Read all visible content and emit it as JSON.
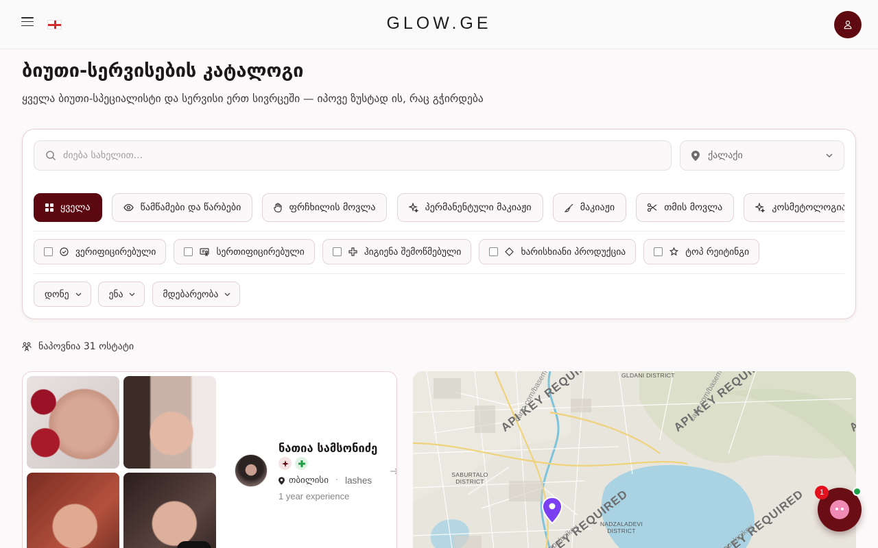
{
  "header": {
    "brand": "GLOW.GE",
    "menu_icon": "hamburger-icon",
    "language_flag": "georgia-flag-icon",
    "user_icon": "user-icon"
  },
  "hero": {
    "title": "ბიუთი-სერვისების კატალოგი",
    "subtitle": "ყველა ბიუთი-სპეციალისტი და სერვისი ერთ სივრცეში — იპოვე ზუსტად ის, რაც გჭირდება"
  },
  "filters": {
    "search_placeholder": "ძიება სახელით...",
    "city_label": "ქალაქი",
    "categories": [
      {
        "label": "ყველა",
        "icon": "grid-icon",
        "active": true
      },
      {
        "label": "წამწამები და წარბები",
        "icon": "eye-icon",
        "active": false
      },
      {
        "label": "ფრჩხილის მოვლა",
        "icon": "hand-icon",
        "active": false
      },
      {
        "label": "პერმანენტული მაკიაჟი",
        "icon": "sparkle-icon",
        "active": false
      },
      {
        "label": "მაკიაჟი",
        "icon": "brush-icon",
        "active": false
      },
      {
        "label": "თმის მოვლა",
        "icon": "scissors-icon",
        "active": false
      },
      {
        "label": "კოსმეტოლოგია და",
        "icon": "sparkle-icon",
        "active": false
      }
    ],
    "checks": [
      {
        "label": "ვერიფიცირებული",
        "icon": "check-circle-icon"
      },
      {
        "label": "სერთიფიცირებული",
        "icon": "certificate-icon"
      },
      {
        "label": "ჰიგიენა შემოწმებული",
        "icon": "plus-badge-icon"
      },
      {
        "label": "ხარისხიანი პროდუქცია",
        "icon": "diamond-icon"
      },
      {
        "label": "ტოპ რეიტინგი",
        "icon": "star-icon"
      }
    ],
    "dropdowns": [
      {
        "label": "დონე"
      },
      {
        "label": "ენა"
      },
      {
        "label": "მდებარეობა"
      }
    ]
  },
  "results": {
    "count_text": "ნაპოვნია 31 ოსტატი"
  },
  "master": {
    "name": "ნათია სამსონიძე",
    "city": "თბილისი",
    "specialty": "lashes",
    "experience": "1 year experience"
  },
  "map": {
    "districts": [
      "GLDANI DISTRICT",
      "SABURTALO DISTRICT",
      "NADZALADEVI DISTRICT"
    ],
    "watermark": "API KEY REQUIRED",
    "watermark_small_1": "carto.com/basem",
    "watermark_small_2": "maps/apikey",
    "marker_color": "#7a3ff0"
  },
  "chat": {
    "unread": "1",
    "online": true
  },
  "colors": {
    "accent": "#5b0810",
    "card_border": "#ead0d3"
  }
}
